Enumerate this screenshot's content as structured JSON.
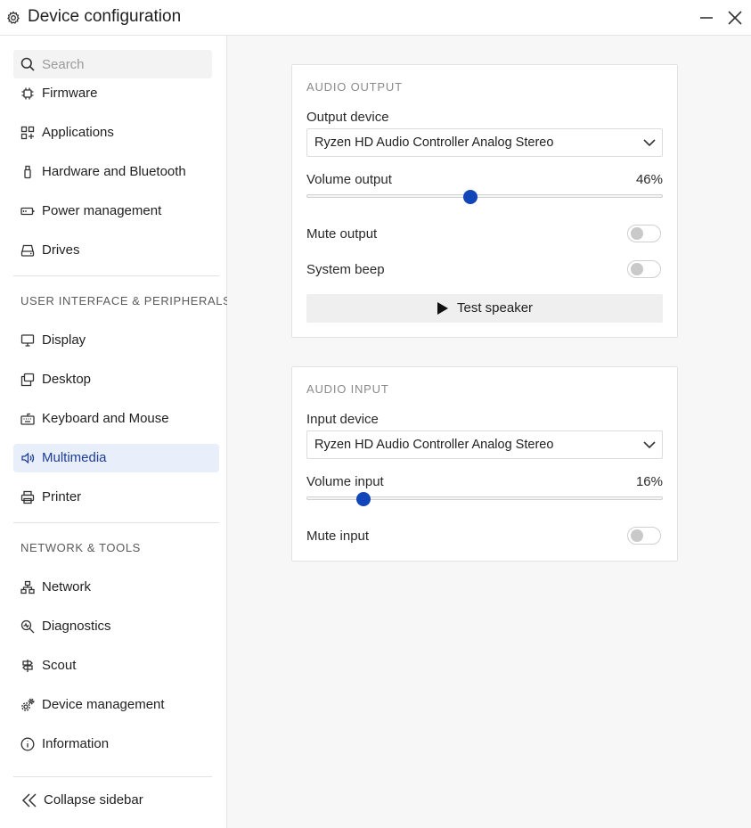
{
  "window": {
    "title": "Device configuration",
    "icon": "gear-icon",
    "controls": [
      "minimize-icon",
      "close-icon"
    ]
  },
  "sidebar": {
    "search_placeholder": "Search",
    "items_top": [
      {
        "label": "Firmware",
        "icon": "chip-icon"
      },
      {
        "label": "Applications",
        "icon": "apps-grid-icon"
      },
      {
        "label": "Hardware and Bluetooth",
        "icon": "usb-icon"
      },
      {
        "label": "Power management",
        "icon": "battery-icon"
      },
      {
        "label": "Drives",
        "icon": "drive-icon"
      }
    ],
    "section_ui": "USER INTERFACE & PERIPHERALS",
    "items_ui": [
      {
        "label": "Display",
        "icon": "monitor-icon"
      },
      {
        "label": "Desktop",
        "icon": "desktop-windows-icon"
      },
      {
        "label": "Keyboard and Mouse",
        "icon": "keyboard-icon"
      },
      {
        "label": "Multimedia",
        "icon": "speaker-icon",
        "active": true
      },
      {
        "label": "Printer",
        "icon": "printer-icon"
      }
    ],
    "section_net": "NETWORK & TOOLS",
    "items_net": [
      {
        "label": "Network",
        "icon": "network-icon"
      },
      {
        "label": "Diagnostics",
        "icon": "diagnostics-icon"
      },
      {
        "label": "Scout",
        "icon": "signpost-icon"
      },
      {
        "label": "Device management",
        "icon": "gears-icon"
      },
      {
        "label": "Information",
        "icon": "info-icon"
      }
    ],
    "collapse_label": "Collapse sidebar"
  },
  "audio_output": {
    "header": "AUDIO OUTPUT",
    "device_label": "Output device",
    "device_value": "Ryzen HD Audio Controller Analog Stereo",
    "volume_label": "Volume output",
    "volume_text": "46%",
    "volume_value": 0.46,
    "mute_label": "Mute output",
    "mute_on": false,
    "beep_label": "System beep",
    "beep_on": false,
    "test_label": "Test speaker"
  },
  "audio_input": {
    "header": "AUDIO INPUT",
    "device_label": "Input device",
    "device_value": "Ryzen HD Audio Controller Analog Stereo",
    "volume_label": "Volume input",
    "volume_text": "16%",
    "volume_value": 0.16,
    "mute_label": "Mute input",
    "mute_on": false
  },
  "colors": {
    "accent": "#1245b8",
    "active_bg": "#e9eefb",
    "active_text": "#1d3e94"
  }
}
